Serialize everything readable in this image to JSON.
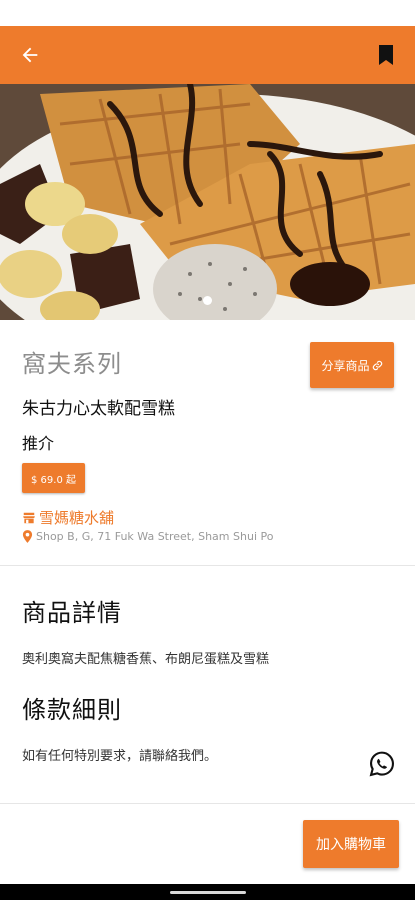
{
  "header": {
    "back_icon": "arrow-left-icon",
    "bookmark_icon": "bookmark-icon",
    "accent_color": "#ee7b2c"
  },
  "gallery": {
    "image_description": "waffle-with-banana-brownie-ice-cream",
    "page_count": 1,
    "current_page": 1
  },
  "product": {
    "category": "窩夫系列",
    "name": "朱古力心太軟配雪糕",
    "tag": "推介",
    "price": "$ 69.0 起",
    "share_label": "分享商品",
    "share_icon": "link-icon"
  },
  "shop": {
    "name": "雪媽糖水舖",
    "shop_icon": "store-icon",
    "address": "Shop B, G, 71 Fuk Wa Street, Sham Shui Po",
    "address_icon": "location-pin-icon"
  },
  "details": {
    "title": "商品詳情",
    "text": "奧利奧窩夫配焦糖香蕉、布朗尼蛋糕及雪糕"
  },
  "terms": {
    "title": "條款細則",
    "text": "如有任何特別要求，請聯絡我們。",
    "contact_icon": "whatsapp-icon"
  },
  "footer": {
    "add_to_cart_label": "加入購物車"
  }
}
